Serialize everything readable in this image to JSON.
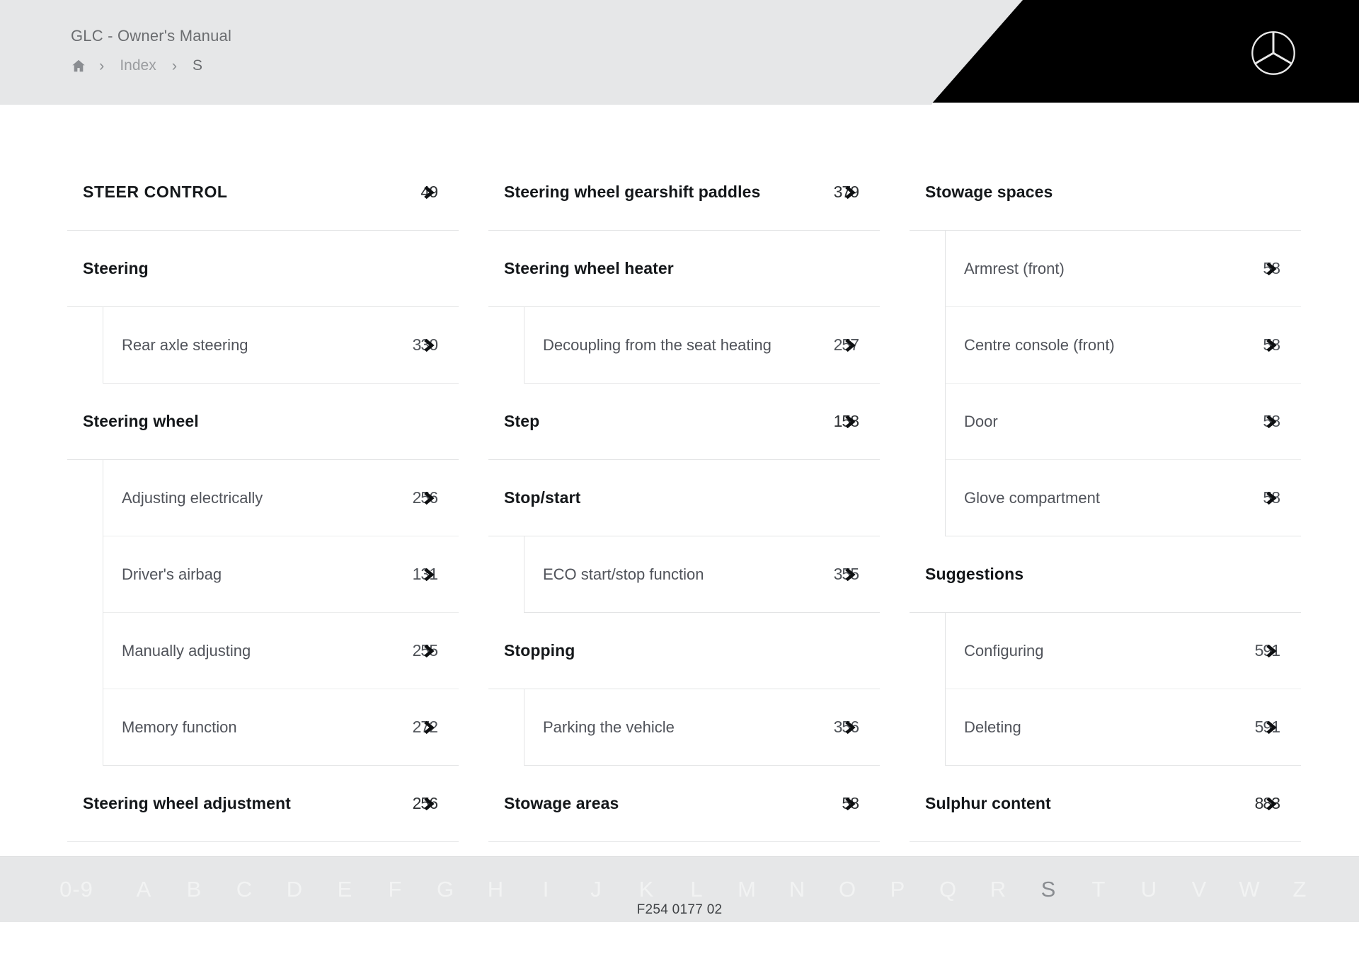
{
  "header": {
    "title": "GLC - Owner's Manual",
    "breadcrumb": {
      "home_icon": "home-icon",
      "separator": "›",
      "items": [
        {
          "label": "Index"
        },
        {
          "label": "S"
        }
      ]
    },
    "logo": "mercedes-benz-star-icon"
  },
  "index": {
    "columns": [
      {
        "entries": [
          {
            "level": 1,
            "label": "STEER CONTROL",
            "page": "49",
            "uppercase": true
          },
          {
            "level": 1,
            "label": "Steering",
            "page": ""
          },
          {
            "level": 2,
            "label": "Rear axle steering",
            "page": "330"
          },
          {
            "level": 1,
            "label": "Steering wheel",
            "page": ""
          },
          {
            "level": 2,
            "label": "Adjusting electrically",
            "page": "256"
          },
          {
            "level": 2,
            "label": "Driver's airbag",
            "page": "131"
          },
          {
            "level": 2,
            "label": "Manually adjusting",
            "page": "255"
          },
          {
            "level": 2,
            "label": "Memory function",
            "page": "272"
          },
          {
            "level": 1,
            "label": "Steering wheel adjustment",
            "page": "256"
          }
        ]
      },
      {
        "entries": [
          {
            "level": 1,
            "label": "Steering wheel gearshift paddles",
            "page": "379"
          },
          {
            "level": 1,
            "label": "Steering wheel heater",
            "page": ""
          },
          {
            "level": 2,
            "label": "Decoupling from the seat heating",
            "page": "257"
          },
          {
            "level": 1,
            "label": "Step",
            "page": "158"
          },
          {
            "level": 1,
            "label": "Stop/start",
            "page": ""
          },
          {
            "level": 2,
            "label": "ECO start/stop function",
            "page": "355"
          },
          {
            "level": 1,
            "label": "Stopping",
            "page": ""
          },
          {
            "level": 2,
            "label": "Parking the vehicle",
            "page": "356"
          },
          {
            "level": 1,
            "label": "Stowage areas",
            "page": "58"
          }
        ]
      },
      {
        "entries": [
          {
            "level": 1,
            "label": "Stowage spaces",
            "page": ""
          },
          {
            "level": 2,
            "label": "Armrest (front)",
            "page": "58"
          },
          {
            "level": 2,
            "label": "Centre console (front)",
            "page": "58"
          },
          {
            "level": 2,
            "label": "Door",
            "page": "58"
          },
          {
            "level": 2,
            "label": "Glove compartment",
            "page": "58"
          },
          {
            "level": 1,
            "label": "Suggestions",
            "page": ""
          },
          {
            "level": 2,
            "label": "Configuring",
            "page": "591"
          },
          {
            "level": 2,
            "label": "Deleting",
            "page": "591"
          },
          {
            "level": 1,
            "label": "Sulphur content",
            "page": "883"
          }
        ]
      }
    ]
  },
  "alphabet_bar": {
    "letters": [
      "0-9",
      "A",
      "B",
      "C",
      "D",
      "E",
      "F",
      "G",
      "H",
      "I",
      "J",
      "K",
      "L",
      "M",
      "N",
      "O",
      "P",
      "Q",
      "R",
      "S",
      "T",
      "U",
      "V",
      "W",
      "Z"
    ],
    "active": "S"
  },
  "footer": {
    "code": "F254 0177 02"
  },
  "colors": {
    "header_bg": "#e6e7e8",
    "banner_bg": "#000000",
    "page_bg": "#ffffff",
    "text_primary": "#14171a",
    "text_secondary": "#50535a",
    "text_muted": "#9a9c9f",
    "rule": "#e3e4e5",
    "alpha_letter": "#f2f3f3",
    "alpha_active": "#8a8d91"
  }
}
